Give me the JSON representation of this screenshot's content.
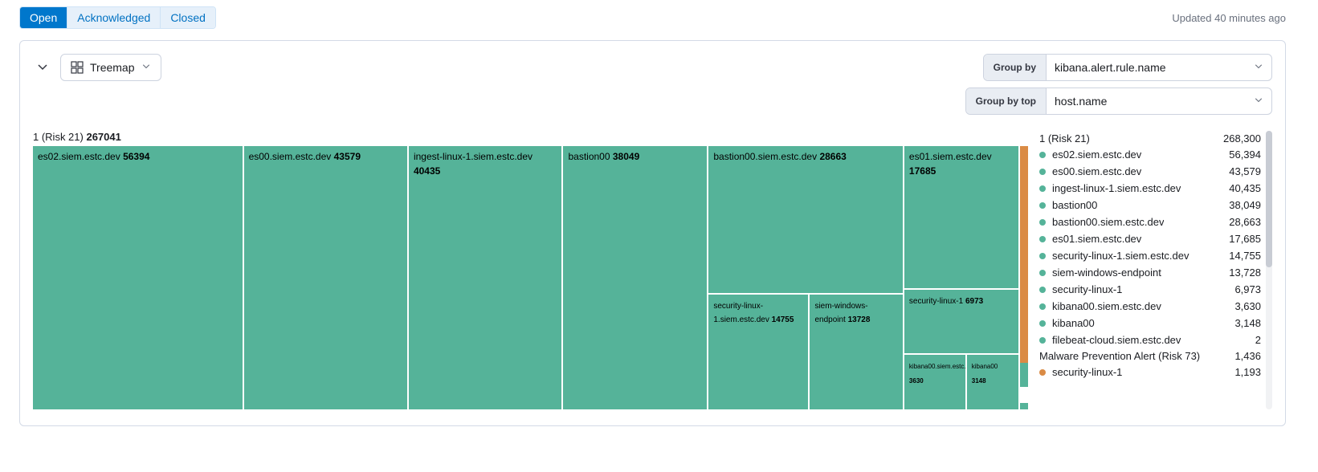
{
  "tabs": {
    "open": "Open",
    "ack": "Acknowledged",
    "closed": "Closed"
  },
  "updated_text": "Updated 40 minutes ago",
  "view": {
    "label": "Treemap"
  },
  "group": {
    "by_label": "Group by",
    "by_value": "kibana.alert.rule.name",
    "top_label": "Group by top",
    "top_value": "host.name"
  },
  "treemap_title_prefix": "1 (Risk 21) ",
  "treemap_title_value": "267041",
  "cells": {
    "es02_name": "es02.siem.estc.dev",
    "es02_v": "56394",
    "es00_name": "es00.siem.estc.dev",
    "es00_v": "43579",
    "ingest_name": "ingest-linux-1.siem.estc.dev",
    "ingest_v": "40435",
    "bastion00_name": "bastion00",
    "bastion00_v": "38049",
    "bastion_siem_name": "bastion00.siem.estc.dev",
    "bastion_siem_v": "28663",
    "es01_name": "es01.siem.estc.dev",
    "es01_v": "17685",
    "seclinux1siem_name": "security-linux-1.siem.estc.dev",
    "seclinux1siem_v": "14755",
    "siemwin_name": "siem-windows-endpoint",
    "siemwin_v": "13728",
    "seclinux1_name": "security-linux-1",
    "seclinux1_v": "6973",
    "kibana00siem_name": "kibana00.siem.estc.dev",
    "kibana00siem_v": "3630",
    "kibana00_name": "kibana00",
    "kibana00_v": "3148"
  },
  "legend": {
    "header_label": "1 (Risk 21)",
    "header_value": "268,300",
    "items": [
      {
        "color": "green",
        "label": "es02.siem.estc.dev",
        "value": "56,394"
      },
      {
        "color": "green",
        "label": "es00.siem.estc.dev",
        "value": "43,579"
      },
      {
        "color": "green",
        "label": "ingest-linux-1.siem.estc.dev",
        "value": "40,435"
      },
      {
        "color": "green",
        "label": "bastion00",
        "value": "38,049"
      },
      {
        "color": "green",
        "label": "bastion00.siem.estc.dev",
        "value": "28,663"
      },
      {
        "color": "green",
        "label": "es01.siem.estc.dev",
        "value": "17,685"
      },
      {
        "color": "green",
        "label": "security-linux-1.siem.estc.dev",
        "value": "14,755"
      },
      {
        "color": "green",
        "label": "siem-windows-endpoint",
        "value": "13,728"
      },
      {
        "color": "green",
        "label": "security-linux-1",
        "value": "6,973"
      },
      {
        "color": "green",
        "label": "kibana00.siem.estc.dev",
        "value": "3,630"
      },
      {
        "color": "green",
        "label": "kibana00",
        "value": "3,148"
      },
      {
        "color": "green",
        "label": "filebeat-cloud.siem.estc.dev",
        "value": "2"
      }
    ],
    "header2_label": "Malware Prevention Alert (Risk 73)",
    "header2_value": "1,436",
    "items2": [
      {
        "color": "orange",
        "label": "security-linux-1",
        "value": "1,193"
      }
    ]
  },
  "chart_data": {
    "type": "treemap",
    "title": "1 (Risk 21) 267041",
    "groups": [
      {
        "name": "1 (Risk 21)",
        "total": 268300,
        "color": "#55b399",
        "children": [
          {
            "name": "es02.siem.estc.dev",
            "value": 56394
          },
          {
            "name": "es00.siem.estc.dev",
            "value": 43579
          },
          {
            "name": "ingest-linux-1.siem.estc.dev",
            "value": 40435
          },
          {
            "name": "bastion00",
            "value": 38049
          },
          {
            "name": "bastion00.siem.estc.dev",
            "value": 28663
          },
          {
            "name": "es01.siem.estc.dev",
            "value": 17685
          },
          {
            "name": "security-linux-1.siem.estc.dev",
            "value": 14755
          },
          {
            "name": "siem-windows-endpoint",
            "value": 13728
          },
          {
            "name": "security-linux-1",
            "value": 6973
          },
          {
            "name": "kibana00.siem.estc.dev",
            "value": 3630
          },
          {
            "name": "kibana00",
            "value": 3148
          },
          {
            "name": "filebeat-cloud.siem.estc.dev",
            "value": 2
          }
        ]
      },
      {
        "name": "Malware Prevention Alert (Risk 73)",
        "total": 1436,
        "color": "#da8b45",
        "children": [
          {
            "name": "security-linux-1",
            "value": 1193
          }
        ]
      }
    ]
  }
}
